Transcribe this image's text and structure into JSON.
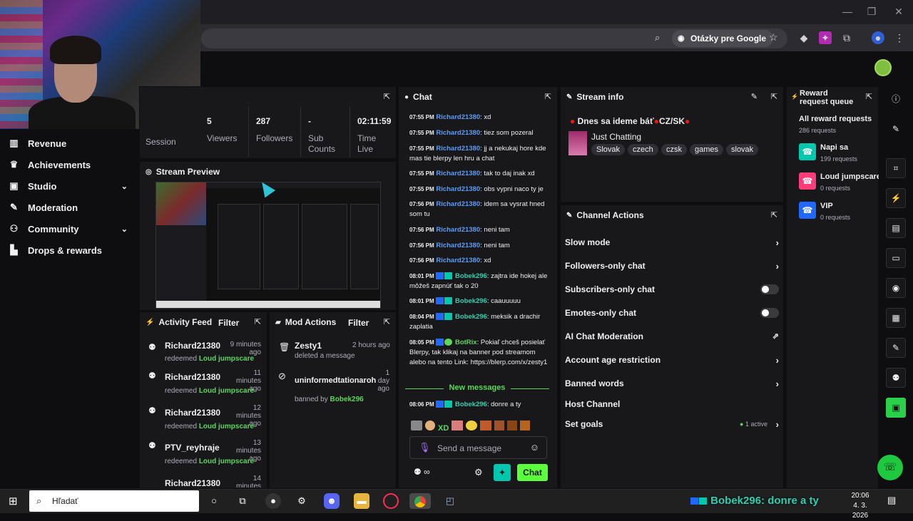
{
  "browser": {
    "google_chip": "Otázky pre Google",
    "window_controls": [
      "—",
      "❐",
      "✕"
    ]
  },
  "sidebar": {
    "items": [
      {
        "label": "Revenue",
        "icon": "chart-icon"
      },
      {
        "label": "Achievements",
        "icon": "trophy-icon"
      },
      {
        "label": "Studio",
        "icon": "studio-icon",
        "chevron": true
      },
      {
        "label": "Moderation",
        "icon": "wrench-icon"
      },
      {
        "label": "Community",
        "icon": "people-icon",
        "chevron": true
      },
      {
        "label": "Drops & rewards",
        "icon": "drops-icon"
      }
    ]
  },
  "stats": {
    "session_label": "Session",
    "viewers_value": "5",
    "viewers_label": "Viewers",
    "followers_value": "287",
    "followers_label": "Followers",
    "sub_value": "-",
    "sub_label": "Sub Counts",
    "time_value": "02:11:59",
    "time_label": "Time Live"
  },
  "preview": {
    "title": "Stream Preview"
  },
  "activity": {
    "title": "Activity Feed",
    "filter": "Filter",
    "items": [
      {
        "name": "Richard21380",
        "time": "9 minutes ago",
        "action": "redeemed",
        "reward": "Loud jumpscare"
      },
      {
        "name": "Richard21380",
        "time": "11 minutes ago",
        "action": "redeemed",
        "reward": "Loud jumpscare"
      },
      {
        "name": "Richard21380",
        "time": "12 minutes ago",
        "action": "redeemed",
        "reward": "Loud jumpscare"
      },
      {
        "name": "PTV_reyhraje",
        "time": "13 minutes ago",
        "action": "redeemed",
        "reward": "Loud jumpscare"
      },
      {
        "name": "Richard21380",
        "time": "14 minutes",
        "action": "",
        "reward": ""
      }
    ]
  },
  "mod": {
    "title": "Mod Actions",
    "filter": "Filter",
    "items": [
      {
        "name": "Zesty1",
        "time": "2 hours ago",
        "desc": "deleted a message",
        "by": ""
      },
      {
        "name": "uninformedtationaroh",
        "time": "1 day ago",
        "desc": "banned by",
        "by": "Bobek296"
      }
    ]
  },
  "chat": {
    "title": "Chat",
    "messages": [
      {
        "t": "07:55 PM",
        "u": "Richard21380",
        "m": "xd"
      },
      {
        "t": "07:55 PM",
        "u": "Richard21380",
        "m": "tiez som pozeral"
      },
      {
        "t": "07:55 PM",
        "u": "Richard21380",
        "m": "jj a nekukaj hore kde mas tie blerpy len hru a chat"
      },
      {
        "t": "07:55 PM",
        "u": "Richard21380",
        "m": "tak to daj inak xd"
      },
      {
        "t": "07:55 PM",
        "u": "Richard21380",
        "m": "obs vypni naco ty je"
      },
      {
        "t": "07:56 PM",
        "u": "Richard21380",
        "m": "idem sa vysrat hned som tu"
      },
      {
        "t": "07:56 PM",
        "u": "Richard21380",
        "m": "neni tam"
      },
      {
        "t": "07:56 PM",
        "u": "Richard21380",
        "m": "neni tam"
      },
      {
        "t": "07:56 PM",
        "u": "Richard21380",
        "m": "xd"
      },
      {
        "t": "08:01 PM",
        "u": "Bobek296",
        "m": "zajtra ide hokej ale môžeš zapnúť tak o 20"
      },
      {
        "t": "08:01 PM",
        "u": "Bobek296",
        "m": "caauuuuu"
      },
      {
        "t": "08:04 PM",
        "u": "Bobek296",
        "m": "meksik a drachir zaplatia"
      },
      {
        "t": "08:05 PM",
        "u": "BotRix",
        "m": "Pokiaľ chceš posielať Blerpy, tak klikaj na banner pod streamom alebo na tento Link: https://blerp.com/x/zesty1"
      }
    ],
    "new_messages": "New messages",
    "last": {
      "t": "08:06 PM",
      "u": "Bobek296",
      "m": "donre a ty"
    },
    "placeholder": "Send a message",
    "chat_button": "Chat",
    "emote_xd": "XD"
  },
  "stream_info": {
    "title": "Stream info",
    "stream_title": "Dnes sa ideme báť",
    "lang": "CZ/SK",
    "category": "Just Chatting",
    "tags": [
      "Slovak",
      "czech",
      "czsk",
      "games",
      "slovak"
    ]
  },
  "channel_actions": {
    "title": "Channel Actions",
    "rows": [
      {
        "label": "Slow mode",
        "kind": "chevron"
      },
      {
        "label": "Followers-only chat",
        "kind": "chevron"
      },
      {
        "label": "Subscribers-only chat",
        "kind": "toggle"
      },
      {
        "label": "Emotes-only chat",
        "kind": "toggle"
      },
      {
        "label": "AI Chat Moderation",
        "kind": "external"
      },
      {
        "label": "Account age restriction",
        "kind": "chevron"
      },
      {
        "label": "Banned words",
        "kind": "chevron"
      },
      {
        "label": "Host Channel",
        "kind": "none"
      },
      {
        "label": "Set goals",
        "kind": "chevron",
        "extra": "1 active"
      }
    ]
  },
  "reward_queue": {
    "title": "Reward request queue",
    "all_label": "All reward requests",
    "all_count": "286 requests",
    "items": [
      {
        "name": "Napi sa",
        "count": "199 requests",
        "color": "#00c8af"
      },
      {
        "name": "Loud jumpscare",
        "count": "0 requests",
        "color": "#ff3c7a"
      },
      {
        "name": "VIP",
        "count": "0 requests",
        "color": "#1f69ff"
      }
    ]
  },
  "taskbar": {
    "search": "Hľadať",
    "ticker": "Bobek296: donre a ty",
    "time": "20:06",
    "date": "4. 3. 2026"
  },
  "colors": {
    "accent_green": "#5cd65c",
    "chat_blue": "#5b9cf7",
    "twitch_bg": "#18181b"
  }
}
